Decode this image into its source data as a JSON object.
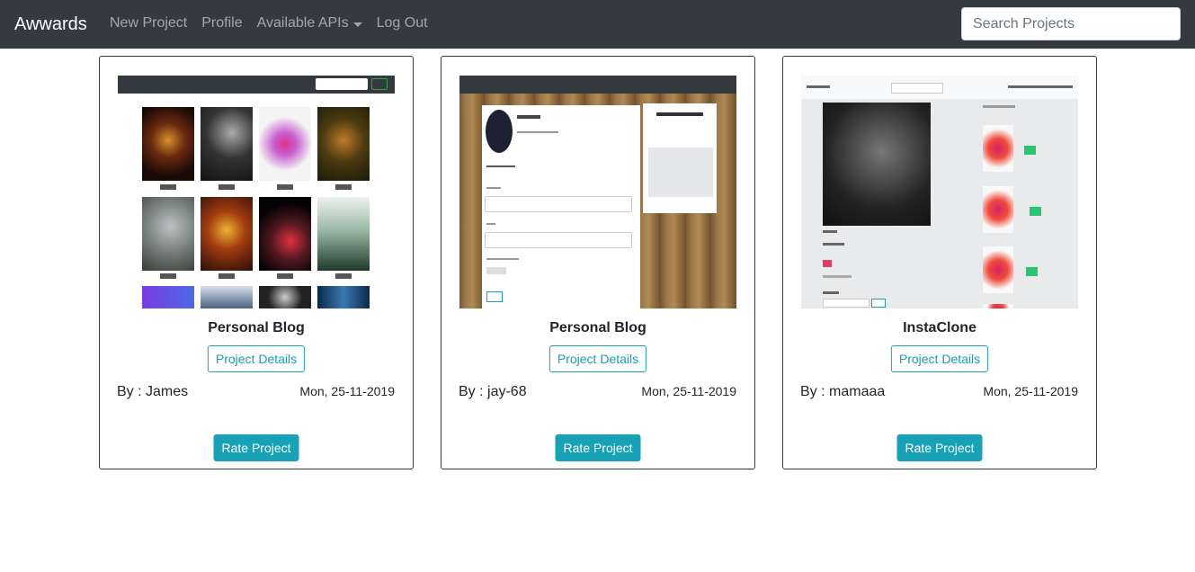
{
  "navbar": {
    "brand": "Awwards",
    "links": [
      "New Project",
      "Profile",
      "Available APIs",
      "Log Out"
    ],
    "search_placeholder": "Search Projects"
  },
  "cards": [
    {
      "title": "Personal Blog",
      "details_label": "Project Details",
      "author": "By : James",
      "date": "Mon, 25-11-2019",
      "rate_label": "Rate Project"
    },
    {
      "title": "Personal Blog",
      "details_label": "Project Details",
      "author": "By : jay-68",
      "date": "Mon, 25-11-2019",
      "rate_label": "Rate Project"
    },
    {
      "title": "InstaClone",
      "details_label": "Project Details",
      "author": "By : mamaaa",
      "date": "Mon, 25-11-2019",
      "rate_label": "Rate Project"
    }
  ],
  "colors": {
    "navbar_bg": "#343a40",
    "accent": "#17a2b8"
  }
}
